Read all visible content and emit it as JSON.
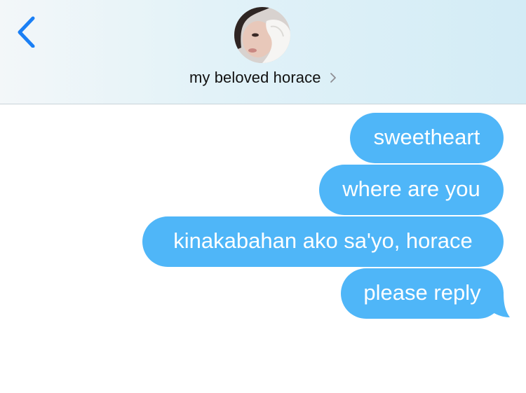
{
  "header": {
    "contact_name": "my beloved horace"
  },
  "messages": [
    {
      "text": "sweetheart",
      "direction": "outgoing"
    },
    {
      "text": "where are you",
      "direction": "outgoing"
    },
    {
      "text": "kinakabahan ako sa'yo, horace",
      "direction": "outgoing"
    },
    {
      "text": "please reply",
      "direction": "outgoing"
    }
  ],
  "colors": {
    "accent": "#1a7ff5",
    "outgoing_bubble": "#4fb6f8",
    "header_bg": "#dff1f8"
  },
  "icons": {
    "back": "chevron-left-icon",
    "contact_details": "chevron-right-icon"
  }
}
